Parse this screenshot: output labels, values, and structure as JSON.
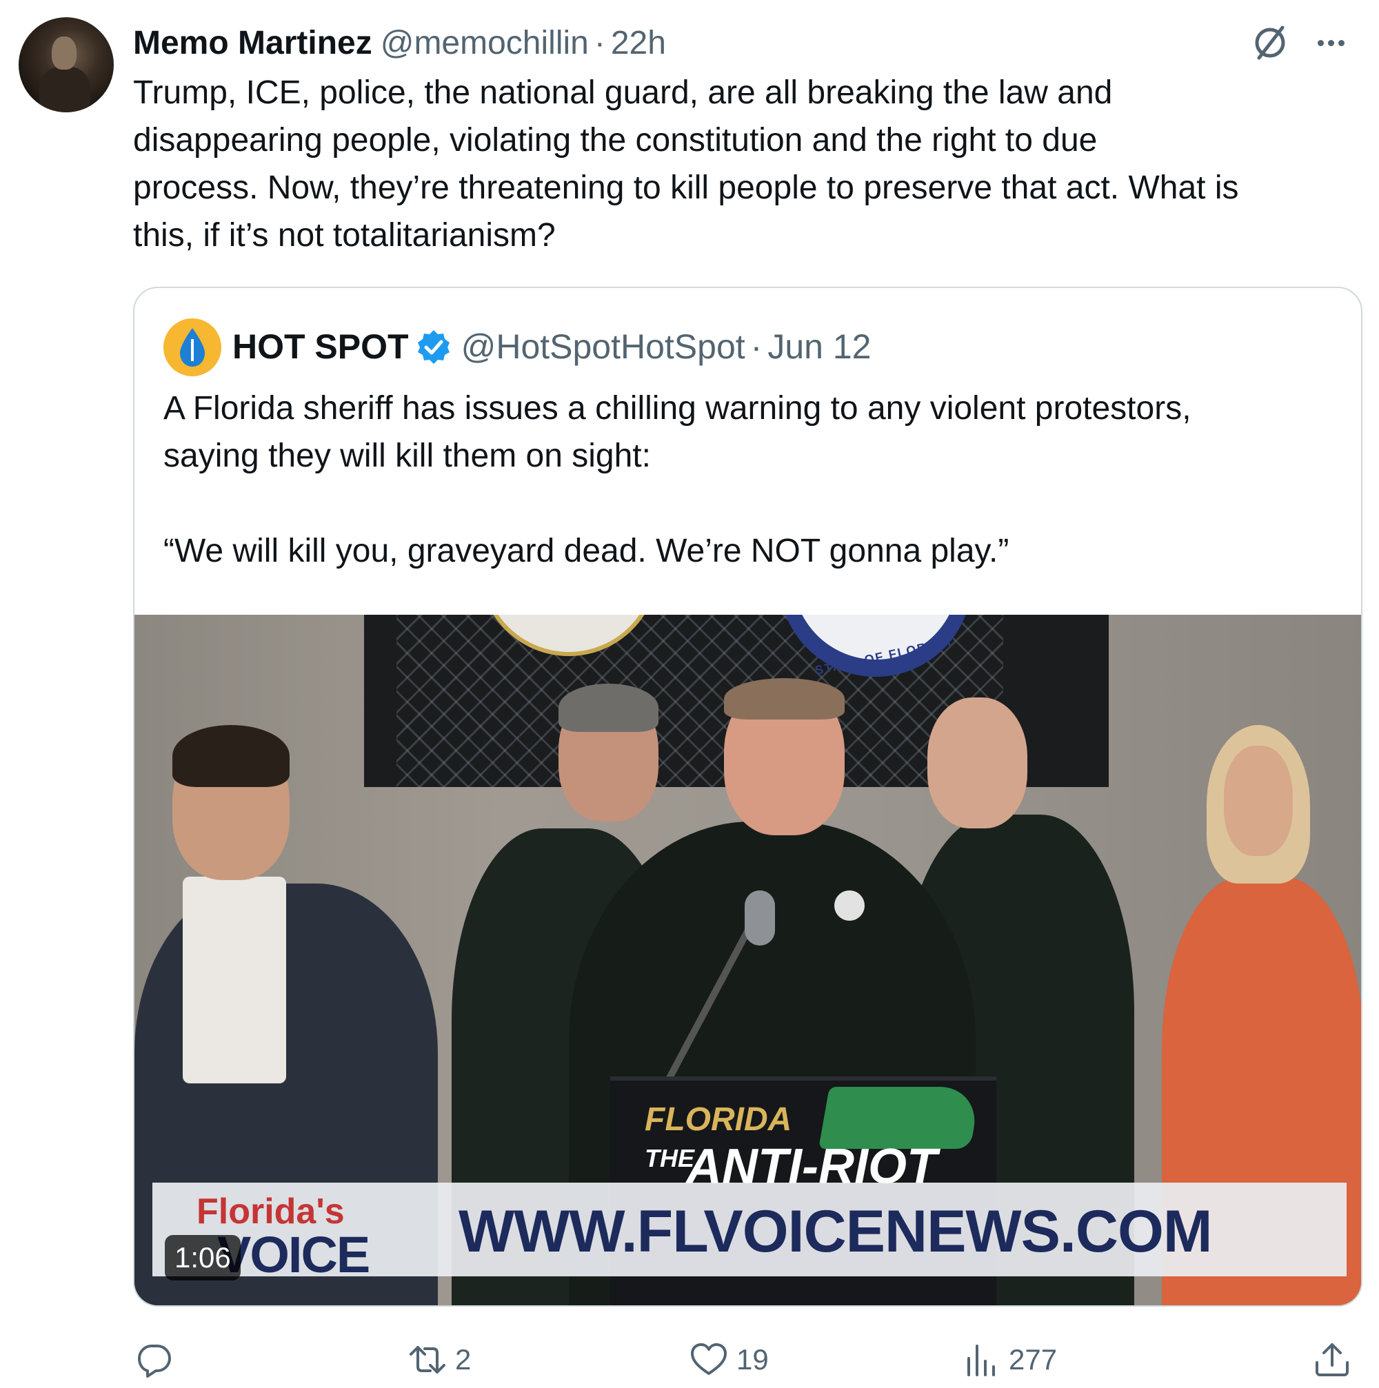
{
  "post": {
    "author_name": "Memo Martinez",
    "author_handle": "@memochillin",
    "separator": "·",
    "time": "22h",
    "text": "Trump, ICE, police, the national guard, are all breaking the law and\ndisappearing people, violating the constitution and the right to due\nprocess. Now, they’re threatening to kill people to preserve that act. What is\nthis, if it’s not totalitarianism?",
    "icons": {
      "grok": "grok-icon",
      "more": "more-icon"
    }
  },
  "quote": {
    "author_name": "HOT SPOT",
    "verified": true,
    "author_handle": "@HotSpotHotSpot",
    "separator": "·",
    "date": "Jun 12",
    "text": "A Florida sheriff has issues a chilling warning to any violent protestors,\nsaying they will kill them on sight:\n\n“We will kill you, graveyard dead. We’re NOT gonna play.”",
    "video": {
      "duration": "1:06",
      "seal_text": "STATE OF FLORIDA",
      "podium_line1": "FLORIDA",
      "podium_the": "THE",
      "podium_line2": "ANTI-RIOT",
      "brand_line1": "Florida's",
      "brand_line2": "VOICE",
      "url_banner": "WWW.FLVOICENEWS.COM"
    }
  },
  "actions": {
    "reply": {
      "icon": "reply-icon",
      "count": ""
    },
    "repost": {
      "icon": "repost-icon",
      "count": "2"
    },
    "like": {
      "icon": "heart-icon",
      "count": "19"
    },
    "views": {
      "icon": "views-icon",
      "count": "277"
    },
    "share": {
      "icon": "share-icon"
    }
  },
  "colors": {
    "text_primary": "#0f1419",
    "text_secondary": "#536471",
    "border": "#cfd9de",
    "verified": "#1d9bf0"
  }
}
